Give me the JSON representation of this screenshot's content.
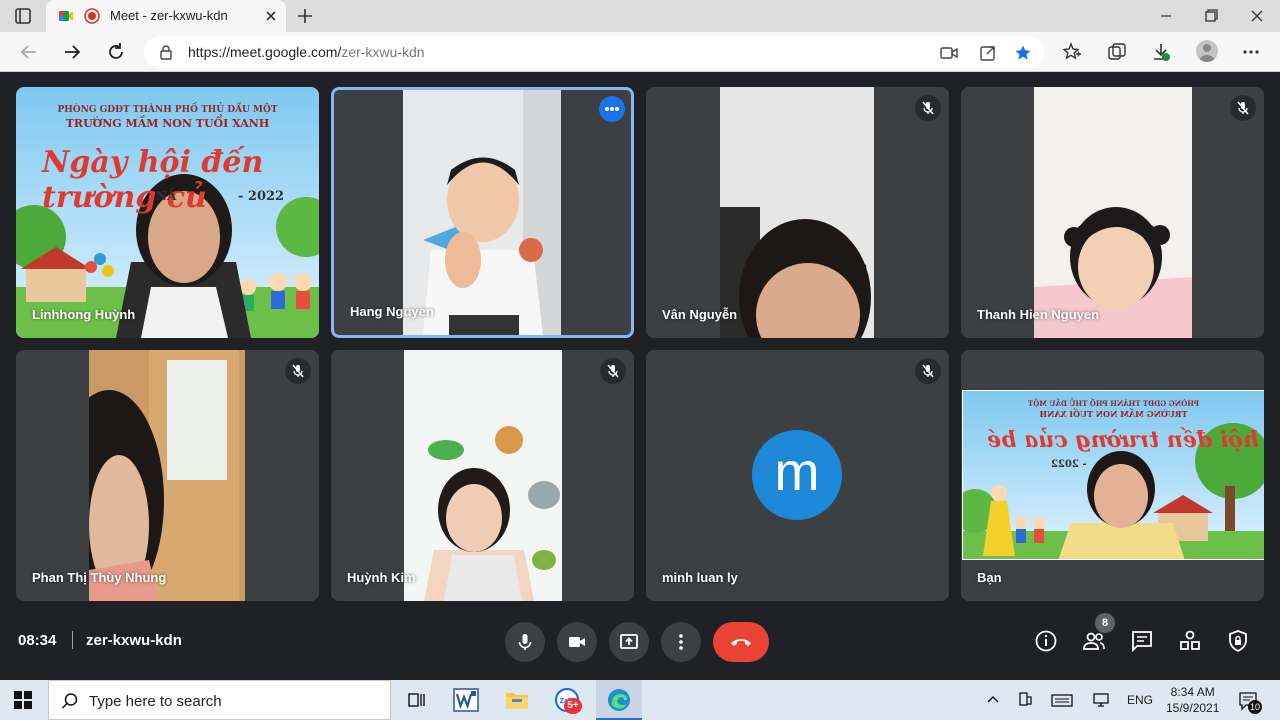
{
  "browser": {
    "tab_title": "Meet - zer-kxwu-kdn",
    "url_host": "https://meet.google.com/",
    "url_path": "zer-kxwu-kdn"
  },
  "banner": {
    "line1": "PHÒNG GDĐT THÀNH PHỐ THỦ DẦU MỘT",
    "line2": "TRƯỜNG MẦM NON TUỔI XANH",
    "headline": "Ngày hội đến trường củ",
    "year": "- 2022",
    "year_left": "NĂ",
    "self_headline": "Ngày hội đến trường của bé",
    "self_year": "- 2022"
  },
  "participants": [
    {
      "name": "Linhhong Huỳnh",
      "muted": false
    },
    {
      "name": "Hang Nguyen",
      "muted": false
    },
    {
      "name": "Vân Nguyễn",
      "muted": true
    },
    {
      "name": "Thanh Hien Nguyen",
      "muted": true
    },
    {
      "name": "Phan Thị Thùy Nhung",
      "muted": true
    },
    {
      "name": "Huỳnh Kim",
      "muted": true
    },
    {
      "name": "minh luan ly",
      "muted": true,
      "avatar_letter": "m"
    },
    {
      "name": "Bạn",
      "muted": false
    }
  ],
  "meeting": {
    "time": "08:34",
    "code": "zer-kxwu-kdn",
    "participant_count": "8"
  },
  "taskbar": {
    "search_placeholder": "Type here to search",
    "zalo_badge": "5+",
    "lang": "ENG",
    "time": "8:34 AM",
    "date": "15/9/2021",
    "notifications": "10"
  },
  "colors": {
    "meet_bg": "#202124",
    "tile_bg": "#3c4043",
    "active_border": "#8ab4f8",
    "hangup": "#ea4335",
    "avatar": "#1e88d8"
  }
}
